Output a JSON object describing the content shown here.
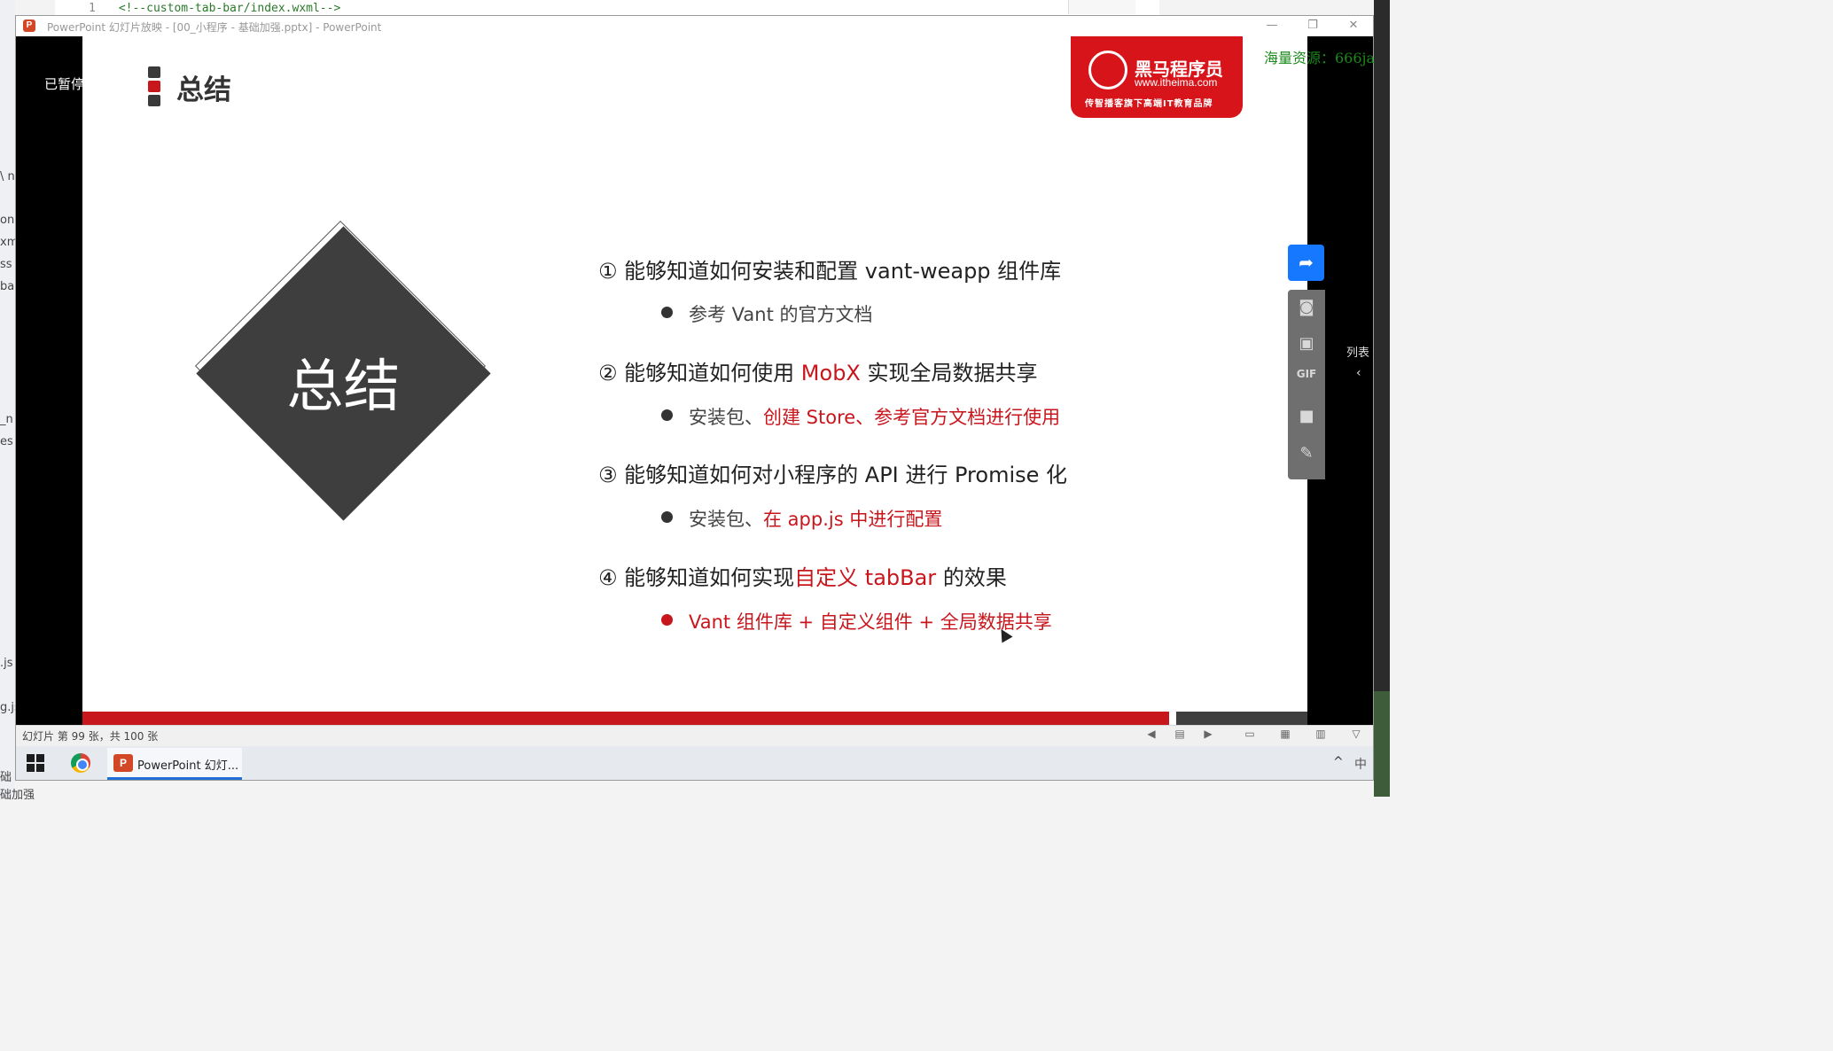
{
  "background_editor": {
    "code_line_number": "1",
    "code_line_text": "<!--custom-tab-bar/index.wxml-->",
    "left_file_fragments": [
      "\\ n",
      "on",
      "xm",
      "ss",
      "bar",
      "_n",
      "es",
      ".js",
      "g.js",
      "础",
      "础加强"
    ]
  },
  "window": {
    "title": "PowerPoint 幻灯片放映 - [00_小程序 - 基础加强.pptx] - PowerPoint",
    "app_icon": "P",
    "minimize": "—",
    "restore": "❐",
    "close": "✕"
  },
  "paused_label": "已暂停",
  "slide": {
    "title": "总结",
    "diamond_text": "总结",
    "logo": {
      "name": "黑马程序员",
      "url": "www.itheima.com",
      "slogan": "传智播客旗下高端IT教育品牌"
    },
    "watermark": "海量资源：666ja",
    "points": [
      {
        "num": "①",
        "text_parts": [
          "能够知道如何安装和配置 vant-weapp 组件库"
        ],
        "sub_parts": [
          "参考 Vant 的官方文档"
        ]
      },
      {
        "num": "②",
        "text_parts": [
          "能够知道如何使用 ",
          "MobX",
          " 实现全局数据共享"
        ],
        "sub_parts": [
          "安装包、",
          "创建 Store、参考官方文档进行使用"
        ]
      },
      {
        "num": "③",
        "text_parts": [
          "能够知道如何对小程序的 API 进行 Promise 化"
        ],
        "sub_parts": [
          "安装包、",
          "在 app.js 中进行配置"
        ]
      },
      {
        "num": "④",
        "text_parts": [
          "能够知道如何实现",
          "自定义 tabBar",
          " 的效果"
        ],
        "sub_parts": [
          "Vant 组件库 + 自定义组件 + 全局数据共享"
        ]
      }
    ],
    "colors": {
      "accent_red": "#c8161d",
      "dark": "#3e3e3e",
      "marker_gray": "#3a3a3a"
    }
  },
  "side_toolbar": {
    "icons": [
      "share-icon",
      "camera-icon",
      "image-icon",
      "gif-icon",
      "video-icon",
      "pen-icon"
    ],
    "list_label": "列表",
    "chevron": "‹"
  },
  "status_bar": {
    "slide_count": "幻灯片 第 99 张，共 100 张"
  },
  "taskbar": {
    "ppt_label": "PowerPoint 幻灯...",
    "tray_up": "^",
    "ime": "中"
  }
}
